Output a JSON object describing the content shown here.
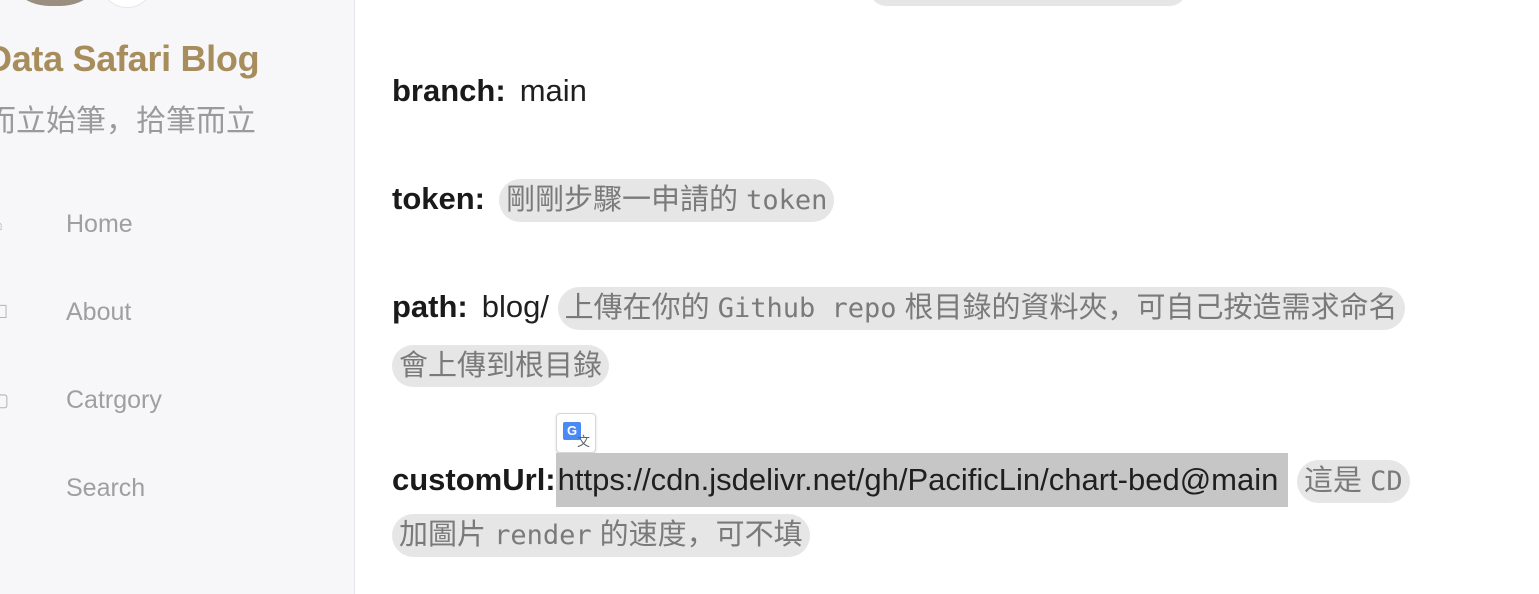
{
  "sidebar": {
    "title": "Data Safari Blog",
    "subtitle": "而立始筆，拾筆而立",
    "items": [
      {
        "icon": "home-icon",
        "glyph": "⌂",
        "label": "Home"
      },
      {
        "icon": "user-icon",
        "glyph": "☐",
        "label": "About"
      },
      {
        "icon": "folder-icon",
        "glyph": "▢",
        "label": "Catrgory"
      },
      {
        "icon": "search-icon",
        "glyph": "⌕",
        "label": "Search"
      }
    ]
  },
  "content": {
    "branch": {
      "key": "branch:",
      "value": "main"
    },
    "token": {
      "key": "token:",
      "note_prefix": "剛剛步驟一申請的 ",
      "note_code": "token"
    },
    "path": {
      "key": "path:",
      "value": "blog/",
      "note_prefix": "上傳在你的 ",
      "note_code": "Github repo",
      "note_suffix": " 根目錄的資料夾，可自己按造需求命名",
      "note_line2": "會上傳到根目錄"
    },
    "customUrl": {
      "key": "customUrl:",
      "value": "https://cdn.jsdelivr.net/gh/PacificLin/chart-bed@main",
      "note_prefix": "這是 ",
      "note_code": "CD",
      "note_line2_prefix": "加圖片 ",
      "note_line2_code": "render",
      "note_line2_suffix": " 的速度，可不填"
    },
    "translate_icon": "google-translate-icon"
  }
}
